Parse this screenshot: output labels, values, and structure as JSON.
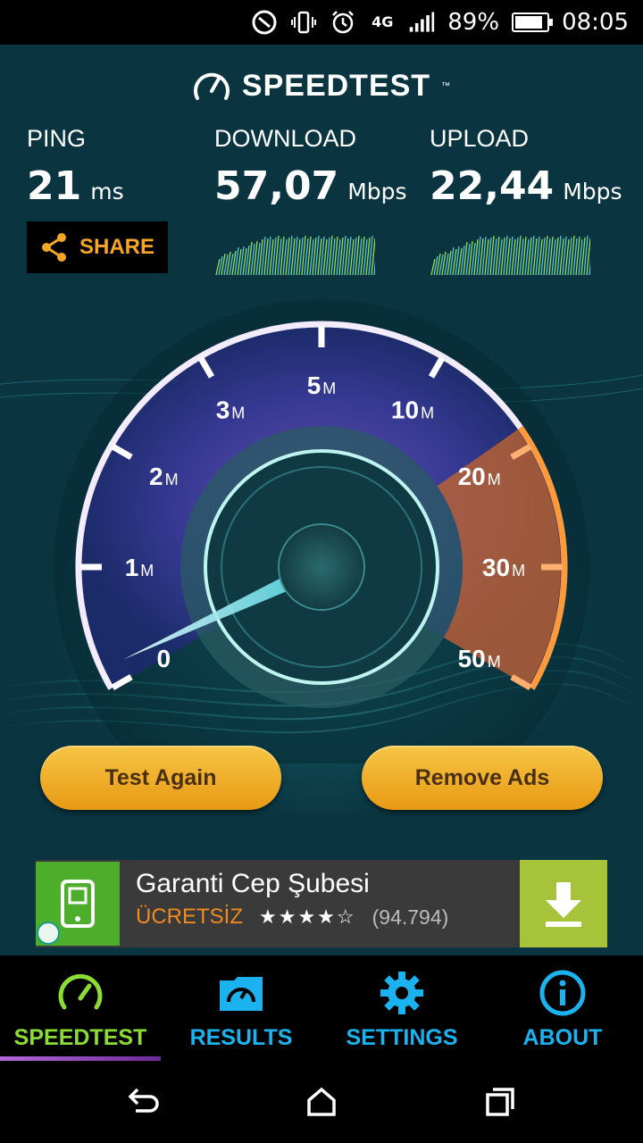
{
  "status_bar": {
    "network": "4G",
    "battery": "89%",
    "battery_level": 0.89,
    "time": "08:05"
  },
  "app": {
    "logo": "SPEEDTEST",
    "trademark": "™"
  },
  "metrics": {
    "ping": {
      "label": "PING",
      "value": "21",
      "unit": "ms"
    },
    "download": {
      "label": "DOWNLOAD",
      "value": "57,07",
      "unit": "Mbps"
    },
    "upload": {
      "label": "UPLOAD",
      "value": "22,44",
      "unit": "Mbps"
    }
  },
  "share_label": "SHARE",
  "gauge": {
    "ticks": [
      {
        "num": "0",
        "suffix": ""
      },
      {
        "num": "1",
        "suffix": "M"
      },
      {
        "num": "2",
        "suffix": "M"
      },
      {
        "num": "3",
        "suffix": "M"
      },
      {
        "num": "5",
        "suffix": "M"
      },
      {
        "num": "10",
        "suffix": "M"
      },
      {
        "num": "20",
        "suffix": "M"
      },
      {
        "num": "30",
        "suffix": "M"
      },
      {
        "num": "50",
        "suffix": "M"
      }
    ]
  },
  "buttons": {
    "test_again": "Test Again",
    "remove_ads": "Remove Ads"
  },
  "ad": {
    "title": "Garanti Cep Şubesi",
    "free_label": "ÜCRETSİZ",
    "stars": "★★★★☆",
    "rating_count": "(94.794)"
  },
  "tabs": [
    {
      "label": "SPEEDTEST",
      "icon": "speedometer-icon"
    },
    {
      "label": "RESULTS",
      "icon": "results-folder-icon"
    },
    {
      "label": "SETTINGS",
      "icon": "gear-icon"
    },
    {
      "label": "ABOUT",
      "icon": "info-icon"
    }
  ],
  "colors": {
    "accent_orange": "#f6a623",
    "tab_blue": "#1ab3f0",
    "tab_active_green": "#8bdd33",
    "button_gold": "#f0ad2a",
    "ad_free_orange": "#f28a1e",
    "download_green": "#a6c33a"
  }
}
